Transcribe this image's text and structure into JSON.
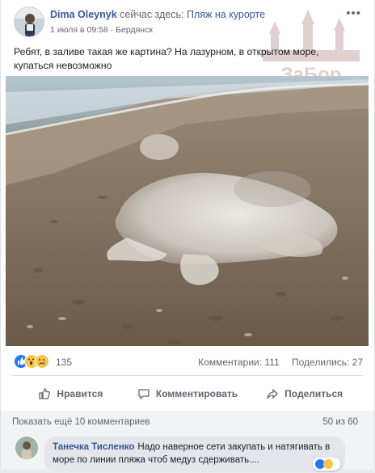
{
  "post": {
    "author": "Dima Oleynyk",
    "here_text": "сейчас здесь:",
    "place": "Пляж на курорте",
    "date": "1 июля в 09:58",
    "separator": "·",
    "location": "Бердянск",
    "menu_icon": "more-dots-icon",
    "text": "Ребят, в заливе такая же картина? На лазурном, в открытом море, купаться невозможно"
  },
  "watermark": {
    "text": "ЗаБор"
  },
  "photo": {
    "description_icon": "jellyfish-on-beach-photo"
  },
  "stats": {
    "reactions": [
      "like",
      "wow",
      "sad"
    ],
    "reaction_count": "135",
    "comments": "Комментарии: 111",
    "shares": "Поделились: 27"
  },
  "actions": {
    "like": "Нравится",
    "comment": "Комментировать",
    "share": "Поделиться"
  },
  "comments": {
    "show_more": "Показать ещё 10 комментариев",
    "count": "50 из 60",
    "items": [
      {
        "author": "Танечка Тисленко",
        "text": "Надо наверное сети закупать и натягивать в море по линии пляжа чтоб медуз сдерживать...."
      }
    ]
  },
  "colors": {
    "link": "#385898",
    "like_blue": "#2078f4",
    "muted": "#606770"
  }
}
